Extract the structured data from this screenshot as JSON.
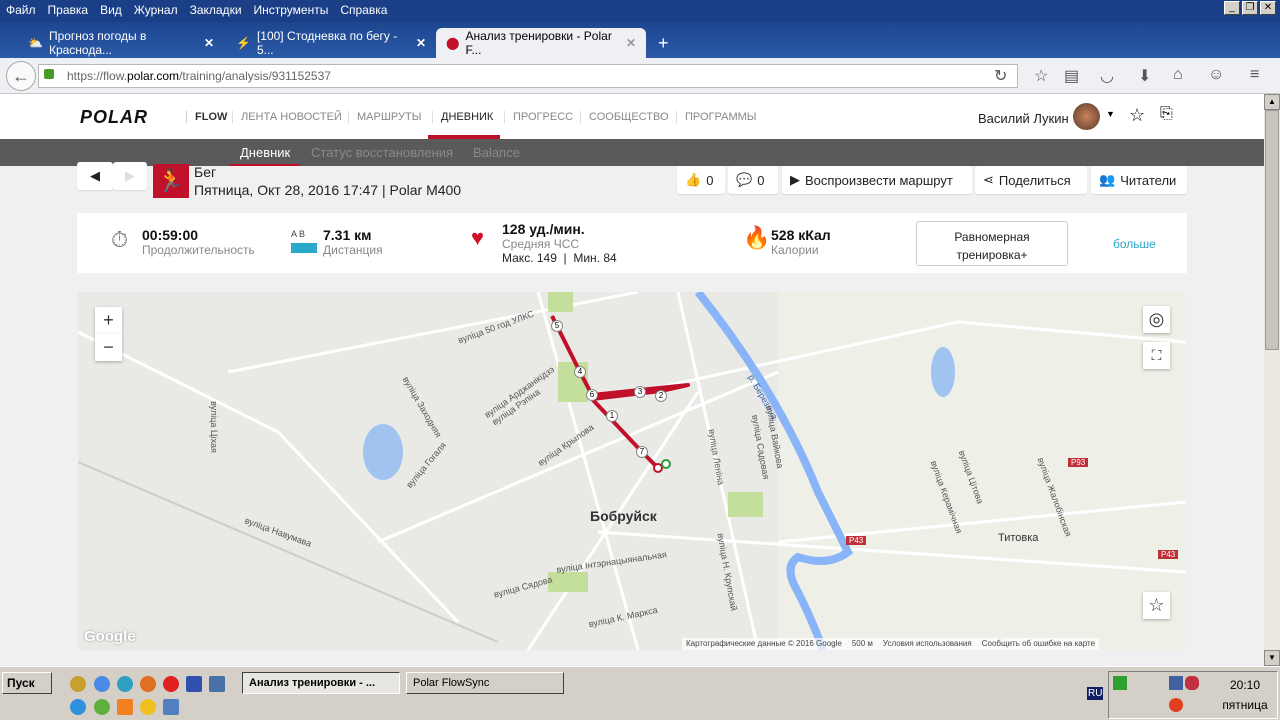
{
  "browser": {
    "menu": [
      "Файл",
      "Правка",
      "Вид",
      "Журнал",
      "Закладки",
      "Инструменты",
      "Справка"
    ],
    "tabs": [
      {
        "title": "Прогноз погоды в Краснода..."
      },
      {
        "title": "[100] Стодневка по бегу - 5..."
      },
      {
        "title": "Анализ тренировки - Polar F..."
      }
    ],
    "url_prefix": "https://flow.",
    "url_domain": "polar.com",
    "url_path": "/training/analysis/931152537"
  },
  "site": {
    "logo": "POLAR",
    "flow": "FLOW",
    "nav": [
      "ЛЕНТА НОВОСТЕЙ",
      "МАРШРУТЫ",
      "ДНЕВНИК",
      "ПРОГРЕСС",
      "СООБЩЕСТВО",
      "ПРОГРАММЫ"
    ],
    "user": "Василий Лукин",
    "subnav": [
      "Дневник",
      "Статус восстановления",
      "Balance"
    ]
  },
  "training": {
    "sport": "Бег",
    "info": "Пятница, Окт 28, 2016 17:47 | Polar M400",
    "likes": "0",
    "comments": "0",
    "replay": "Воспроизвести маршрут",
    "share": "Поделиться",
    "readers": "Читатели",
    "duration": "00:59:00",
    "duration_label": "Продолжительность",
    "ab": "A B",
    "distance": "7.31 км",
    "distance_label": "Дистанция",
    "hr": "128 уд./мин.",
    "hr_label": "Средняя ЧСС",
    "hr_minmax": "Макс. 149  |  Мин. 84",
    "calories": "528 кКал",
    "calories_label": "Калории",
    "benefit": "Равномерная тренировка+",
    "more": "больше"
  },
  "map": {
    "city": "Бобруйск",
    "town": "Титовка",
    "river": "р. Березина",
    "streets": [
      "вуліца 50 год УЛКС",
      "вуліца Арджанікідзэ",
      "вуліца Рэпіна",
      "вуліца Заходняя",
      "вуліца Гогаля",
      "вуліца Крылова",
      "вуліца Леніна",
      "вуліца Вайкова",
      "вуліца Садовая",
      "вуліца Навумава",
      "вуліца Інтэрнацыянальная",
      "вуліца Сядова",
      "вуліца К. Маркса",
      "вуліца Н. Крупскай",
      "вуліца Жалобінская",
      "вуліца Керамічная",
      "вуліца Цітова",
      "вуліца Ціхая"
    ],
    "roads": [
      "P43",
      "P93"
    ],
    "markers": [
      "1",
      "2",
      "3",
      "4",
      "5",
      "6",
      "7"
    ],
    "google": "Google",
    "attribution": "Картографические данные © 2016 Google",
    "scale": "500 м",
    "terms": "Условия использования",
    "report": "Сообщить об ошибке на карте",
    "zoom_in": "+",
    "zoom_out": "−"
  },
  "taskbar": {
    "start": "Пуск",
    "tasks": [
      "Анализ тренировки - ...",
      "Polar FlowSync"
    ],
    "lang": "RU",
    "time": "20:10",
    "day": "пятница"
  },
  "colors": {
    "brand": "#c0102a",
    "link": "#2aa8c8",
    "route": "#c0102a"
  }
}
